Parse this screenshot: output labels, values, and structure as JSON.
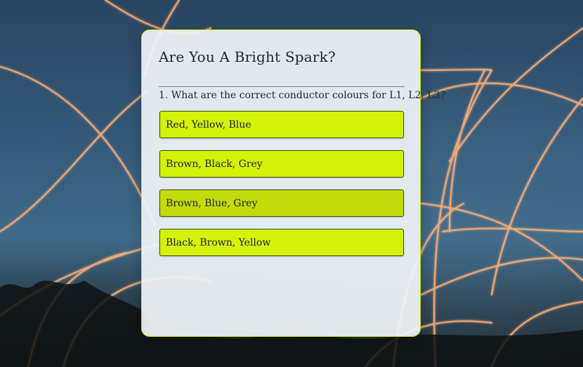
{
  "quiz": {
    "title": "Are You A Bright Spark?",
    "question": "1. What are the correct conductor colours for L1, L2, L3?",
    "answers": [
      "Red, Yellow, Blue",
      "Brown, Black, Grey",
      "Brown, Blue, Grey",
      "Black, Brown, Yellow"
    ]
  },
  "colors": {
    "accent": "#d4f20a",
    "accent_hover": "#c2db0c",
    "card_border": "#c9e60a",
    "text": "#1a2733"
  }
}
